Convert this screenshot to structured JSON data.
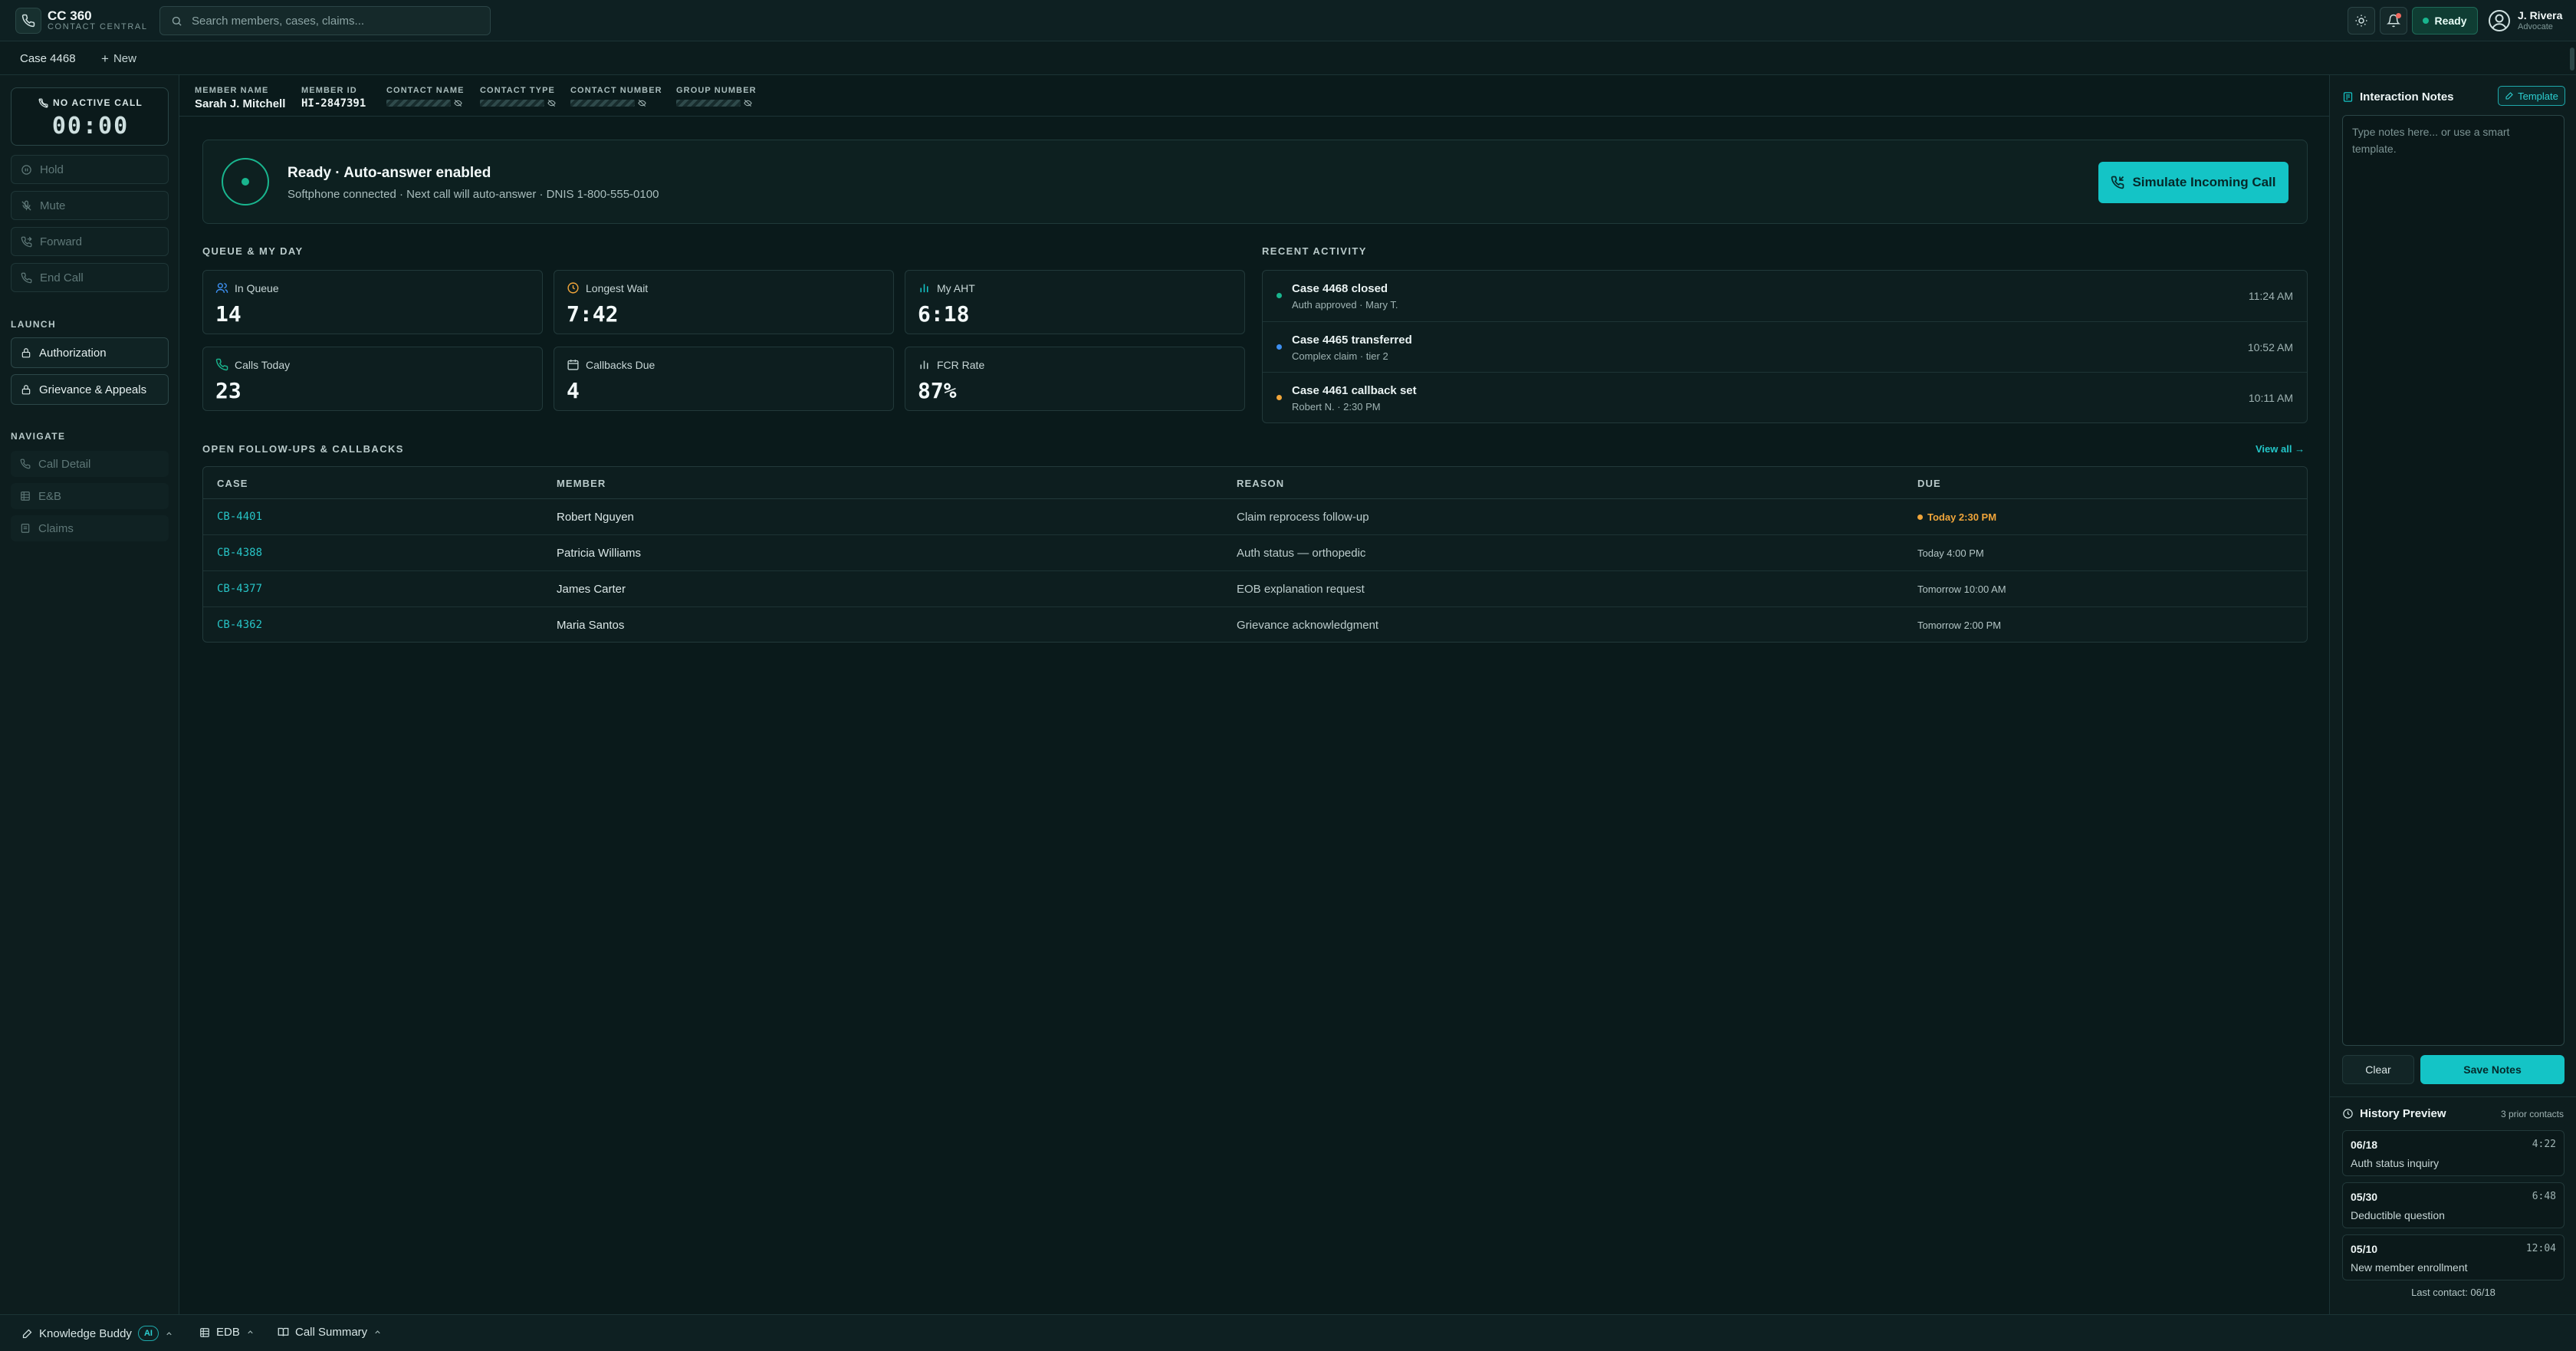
{
  "app": {
    "name": "CC 360",
    "subtitle": "CONTACT CENTRAL"
  },
  "search": {
    "placeholder": "Search members, cases, claims..."
  },
  "status": {
    "label": "Ready",
    "color": "#19b58e"
  },
  "user": {
    "name": "J. Rivera",
    "role": "Advocate"
  },
  "tabs": {
    "current": "Case 4468",
    "new_label": "New"
  },
  "call": {
    "status": "NO ACTIVE CALL",
    "timer": "00:00"
  },
  "controls": [
    "Hold",
    "Mute",
    "Forward",
    "End Call"
  ],
  "launch": {
    "heading": "LAUNCH",
    "items": [
      "Authorization",
      "Grievance & Appeals"
    ]
  },
  "navigate": {
    "heading": "NAVIGATE",
    "items": [
      "Call Detail",
      "E&B",
      "Claims"
    ]
  },
  "member": {
    "name_label": "MEMBER NAME",
    "name": "Sarah J. Mitchell",
    "id_label": "MEMBER ID",
    "id": "HI-2847391",
    "contact_name_label": "CONTACT NAME",
    "contact_type_label": "CONTACT TYPE",
    "contact_number_label": "CONTACT NUMBER",
    "group_number_label": "GROUP NUMBER"
  },
  "banner": {
    "title": "Ready · Auto-answer enabled",
    "subtitle": "Softphone connected · Next call will auto-answer · DNIS 1-800-555-0100",
    "button": "Simulate Incoming Call"
  },
  "queue": {
    "heading": "QUEUE & MY DAY",
    "stats": [
      {
        "label": "In Queue",
        "value": "14",
        "icon": "users-icon"
      },
      {
        "label": "Longest Wait",
        "value": "7:42",
        "icon": "clock-icon"
      },
      {
        "label": "My AHT",
        "value": "6:18",
        "icon": "bar-chart-icon"
      },
      {
        "label": "Calls Today",
        "value": "23",
        "icon": "phone-icon"
      },
      {
        "label": "Callbacks Due",
        "value": "4",
        "icon": "calendar-icon"
      },
      {
        "label": "FCR Rate",
        "value": "87%",
        "icon": "bar-chart-icon"
      }
    ]
  },
  "activity": {
    "heading": "RECENT ACTIVITY",
    "items": [
      {
        "title": "Case 4468 closed",
        "sub": "Auth approved · Mary T.",
        "time": "11:24 AM",
        "color": "#19b58e"
      },
      {
        "title": "Case 4465 transferred",
        "sub": "Complex claim · tier 2",
        "time": "10:52 AM",
        "color": "#3d8ff0"
      },
      {
        "title": "Case 4461 callback set",
        "sub": "Robert N. · 2:30 PM",
        "time": "10:11 AM",
        "color": "#f0a53a"
      }
    ]
  },
  "followups": {
    "heading": "OPEN FOLLOW-UPS & CALLBACKS",
    "view_all": "View all →",
    "columns": [
      "CASE",
      "MEMBER",
      "REASON",
      "DUE"
    ],
    "rows": [
      {
        "case": "CB-4401",
        "member": "Robert Nguyen",
        "reason": "Claim reprocess follow-up",
        "due": "Today 2:30 PM",
        "urgent": true
      },
      {
        "case": "CB-4388",
        "member": "Patricia Williams",
        "reason": "Auth status — orthopedic",
        "due": "Today 4:00 PM",
        "urgent": false
      },
      {
        "case": "CB-4377",
        "member": "James Carter",
        "reason": "EOB explanation request",
        "due": "Tomorrow 10:00 AM",
        "urgent": false
      },
      {
        "case": "CB-4362",
        "member": "Maria Santos",
        "reason": "Grievance acknowledgment",
        "due": "Tomorrow 2:00 PM",
        "urgent": false
      }
    ]
  },
  "notes": {
    "title": "Interaction Notes",
    "template_label": "Template",
    "placeholder": "Type notes here... or use a smart template.",
    "clear": "Clear",
    "save": "Save Notes"
  },
  "history": {
    "title": "History Preview",
    "count": "3 prior contacts",
    "items": [
      {
        "date": "06/18",
        "duration": "4:22",
        "topic": "Auth status inquiry"
      },
      {
        "date": "05/30",
        "duration": "6:48",
        "topic": "Deductible question"
      },
      {
        "date": "05/10",
        "duration": "12:04",
        "topic": "New member enrollment"
      }
    ],
    "last_contact": "Last contact: 06/18"
  },
  "bottom": {
    "knowledge": "Knowledge Buddy",
    "ai_badge": "AI",
    "edb": "EDB",
    "summary": "Call Summary"
  },
  "colors": {
    "accent": "#14c4c6",
    "ready": "#19b58e",
    "warning": "#f0a53a",
    "info": "#3d8ff0"
  }
}
